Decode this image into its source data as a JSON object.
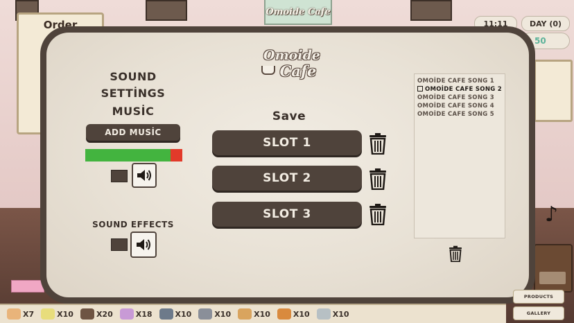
{
  "background": {
    "order_title": "Order",
    "sign_text": "Omoide Cafe",
    "clock": "11:11",
    "day": "DAY (0)",
    "money": "50"
  },
  "logo": {
    "line1": "Omoide",
    "line2": "Cafe"
  },
  "sound_panel": {
    "sound_settings_line1": "SOUND",
    "sound_settings_line2": "SETTİNGS",
    "music_heading": "MUSİC",
    "add_music_label": "ADD MUSİC",
    "music_volume": 0.88,
    "sound_effects_heading": "SOUND EFFECTS",
    "sound_effects_volume_icon": "speaker-icon",
    "music_volume_icon": "speaker-icon"
  },
  "save_panel": {
    "heading": "Save",
    "slots": [
      {
        "label": "SLOT 1"
      },
      {
        "label": "SLOT 2"
      },
      {
        "label": "SLOT 3"
      }
    ]
  },
  "song_list": {
    "songs": [
      {
        "title": "OMOİDE CAFE SONG 1",
        "selected": false
      },
      {
        "title": "OMOİDE CAFE SONG 2",
        "selected": true
      },
      {
        "title": "OMOİDE CAFE SONG 3",
        "selected": false
      },
      {
        "title": "OMOİDE CAFE SONG 4",
        "selected": false
      },
      {
        "title": "OMOİDE CAFE SONG 5",
        "selected": false
      }
    ]
  },
  "inventory": [
    {
      "icon": "cake-icon",
      "color": "#e9b47a",
      "count": "X7"
    },
    {
      "icon": "cheese-icon",
      "color": "#e8dd7c",
      "count": "X10"
    },
    {
      "icon": "cookie-icon",
      "color": "#6e5443",
      "count": "X20"
    },
    {
      "icon": "cupcake-icon",
      "color": "#c89ad6",
      "count": "X18"
    },
    {
      "icon": "mug-icon",
      "color": "#6d7a8a",
      "count": "X10"
    },
    {
      "icon": "onigiri-icon",
      "color": "#8a8f99",
      "count": "X10"
    },
    {
      "icon": "taiyaki-icon",
      "color": "#d9a45e",
      "count": "X10"
    },
    {
      "icon": "pancake-icon",
      "color": "#d98a3e",
      "count": "X10"
    },
    {
      "icon": "skewer-icon",
      "color": "#b7c0c4",
      "count": "X10"
    }
  ],
  "side_buttons": {
    "products": "PRODUCTS",
    "gallery": "GALLERY"
  }
}
